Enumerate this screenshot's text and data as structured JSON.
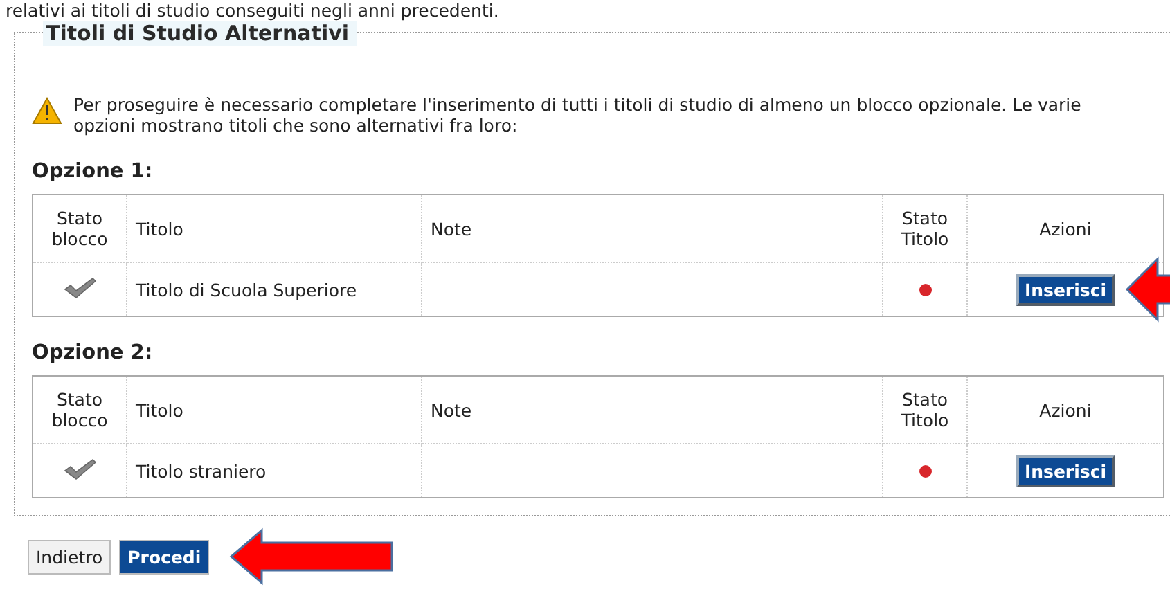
{
  "intro_text": "relativi ai titoli di studio conseguiti negli anni precedenti.",
  "section": {
    "legend": "Titoli di Studio Alternativi",
    "warning": "Per proseguire è necessario completare l'inserimento di tutti i titoli di studio di almeno un blocco opzionale. Le varie opzioni mostrano titoli che sono alternativi fra loro:",
    "options": [
      {
        "heading": "Opzione 1:",
        "columns": [
          "Stato blocco",
          "Titolo",
          "Note",
          "Stato Titolo",
          "Azioni"
        ],
        "rows": [
          {
            "block_complete": true,
            "title": "Titolo di Scuola Superiore",
            "title_inserted": false,
            "action": "Inserisci",
            "arrow": true
          }
        ]
      },
      {
        "heading": "Opzione 2:",
        "columns": [
          "Stato blocco",
          "Titolo",
          "Note",
          "Stato Titolo",
          "Azioni"
        ],
        "rows": [
          {
            "block_complete": true,
            "title": "Titolo straniero",
            "title_inserted": false,
            "action": "Inserisci",
            "arrow": false
          }
        ]
      }
    ]
  },
  "buttons": [
    {
      "label": "Indietro",
      "kind": "plain",
      "arrow": false
    },
    {
      "label": "Procedi",
      "kind": "primary",
      "arrow": true
    }
  ]
}
